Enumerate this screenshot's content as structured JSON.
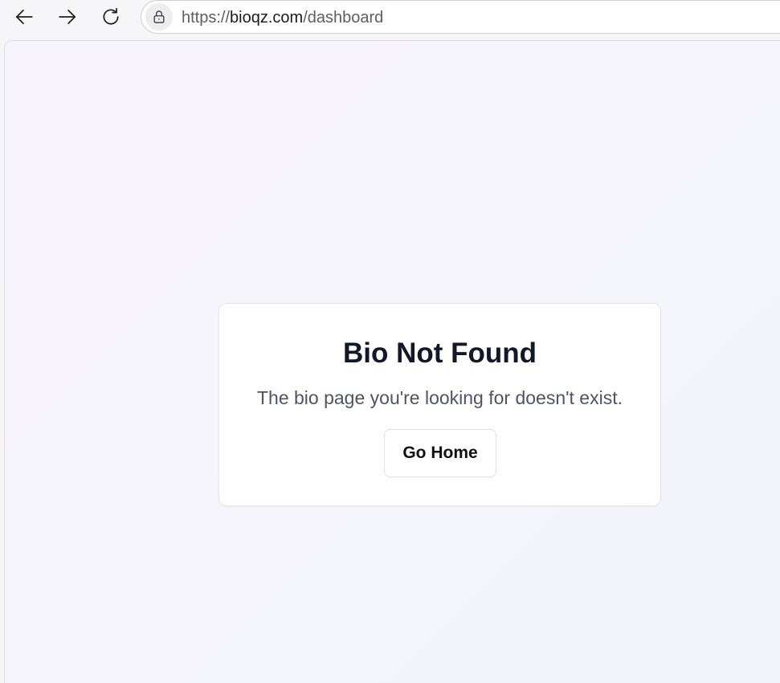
{
  "browser": {
    "url_scheme": "https://",
    "url_host": "bioqz.com",
    "url_path": "/dashboard",
    "icons": {
      "back": "arrow-left-icon",
      "forward": "arrow-right-icon",
      "reload": "reload-icon",
      "lock": "lock-icon"
    }
  },
  "not_found": {
    "title": "Bio Not Found",
    "description": "The bio page you're looking for doesn't exist.",
    "button_label": "Go Home"
  },
  "colors": {
    "title": "#111827",
    "description": "#4b5563",
    "background_start": "#f8f4fd",
    "background_end": "#f3f5fc"
  }
}
